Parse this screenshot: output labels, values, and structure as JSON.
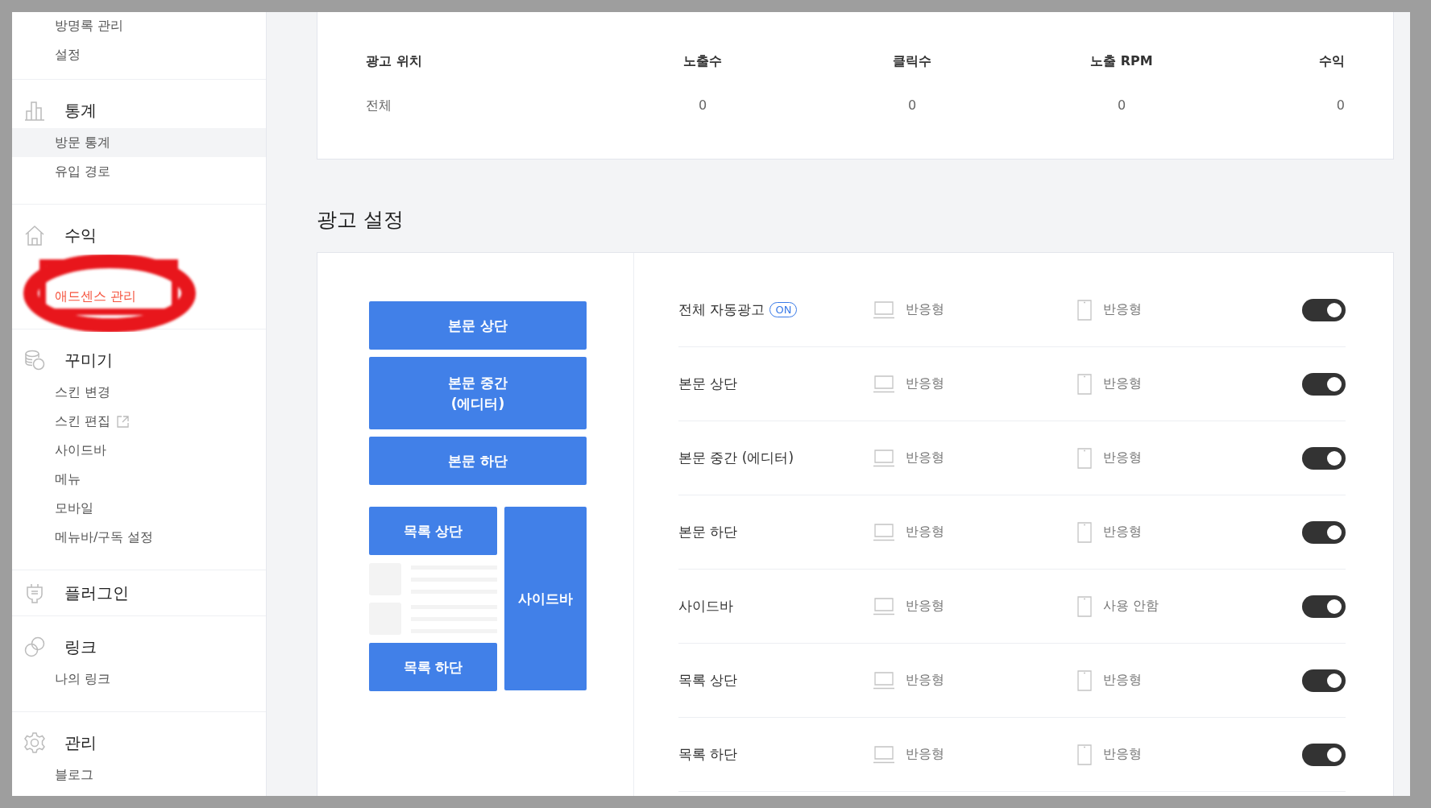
{
  "sidebar": {
    "sections": [
      {
        "items": [
          {
            "label": "방명록 관리",
            "selected": false,
            "highlighted": false,
            "circled": false,
            "external": false
          },
          {
            "label": "설정",
            "selected": false,
            "highlighted": false,
            "circled": false,
            "external": false
          }
        ]
      },
      {
        "title": "통계",
        "items": [
          {
            "label": "방문 통계",
            "selected": false,
            "highlighted": true,
            "circled": false,
            "external": false
          },
          {
            "label": "유입 경로",
            "selected": false,
            "highlighted": false,
            "circled": false,
            "external": false
          }
        ]
      },
      {
        "title": "수익",
        "items": [
          {
            "label": "애드센스 관리",
            "selected": true,
            "highlighted": false,
            "circled": true,
            "external": false
          }
        ]
      },
      {
        "title": "꾸미기",
        "items": [
          {
            "label": "스킨 변경",
            "selected": false,
            "highlighted": false,
            "circled": false,
            "external": false
          },
          {
            "label": "스킨 편집",
            "selected": false,
            "highlighted": false,
            "circled": false,
            "external": true
          },
          {
            "label": "사이드바",
            "selected": false,
            "highlighted": false,
            "circled": false,
            "external": false
          },
          {
            "label": "메뉴",
            "selected": false,
            "highlighted": false,
            "circled": false,
            "external": false
          },
          {
            "label": "모바일",
            "selected": false,
            "highlighted": false,
            "circled": false,
            "external": false
          },
          {
            "label": "메뉴바/구독 설정",
            "selected": false,
            "highlighted": false,
            "circled": false,
            "external": false
          }
        ]
      },
      {
        "title": "플러그인"
      },
      {
        "title": "링크",
        "items": [
          {
            "label": "나의 링크",
            "selected": false,
            "highlighted": false,
            "circled": false,
            "external": false
          }
        ]
      },
      {
        "title": "관리",
        "items": [
          {
            "label": "블로그",
            "selected": false,
            "highlighted": false,
            "circled": false,
            "external": false
          }
        ]
      }
    ]
  },
  "report": {
    "columns": [
      "광고 위치",
      "노출수",
      "클릭수",
      "노출 RPM",
      "수익"
    ],
    "rows": [
      [
        "전체",
        "0",
        "0",
        "0",
        "0"
      ]
    ]
  },
  "ad_settings": {
    "title": "광고 설정",
    "preview": {
      "body_blocks": [
        "본문 상단",
        "본문 중간\n(에디터)",
        "본문 하단"
      ],
      "list_top": "목록 상단",
      "list_bottom": "목록 하단",
      "sidebar_block": "사이드바"
    },
    "rows": [
      {
        "label": "전체 자동광고",
        "badge": "ON",
        "pc": "반응형",
        "mobile": "반응형",
        "on": true
      },
      {
        "label": "본문 상단",
        "pc": "반응형",
        "mobile": "반응형",
        "on": true
      },
      {
        "label": "본문 중간 (에디터)",
        "pc": "반응형",
        "mobile": "반응형",
        "on": true
      },
      {
        "label": "본문 하단",
        "pc": "반응형",
        "mobile": "반응형",
        "on": true
      },
      {
        "label": "사이드바",
        "pc": "반응형",
        "mobile": "사용 안함",
        "on": true
      },
      {
        "label": "목록 상단",
        "pc": "반응형",
        "mobile": "반응형",
        "on": true
      },
      {
        "label": "목록 하단",
        "pc": "반응형",
        "mobile": "반응형",
        "on": true
      }
    ]
  }
}
